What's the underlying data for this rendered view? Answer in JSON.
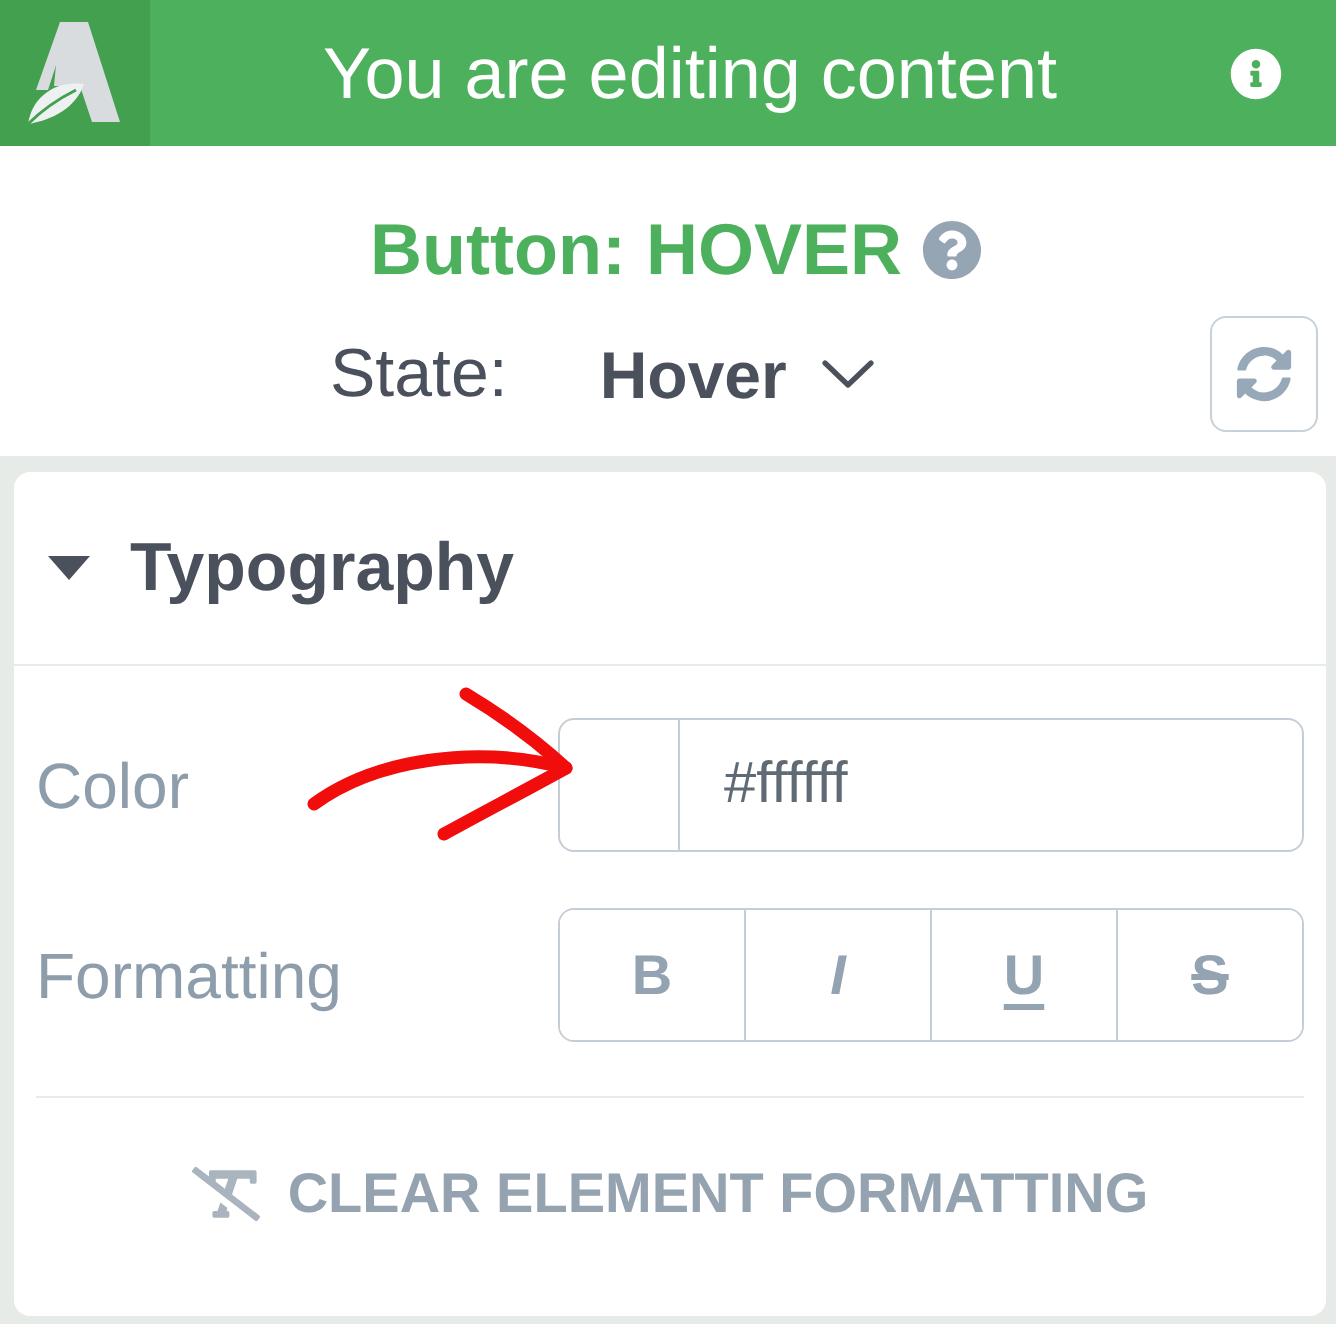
{
  "header": {
    "title": "You are editing content"
  },
  "element": {
    "title": "Button: HOVER"
  },
  "state": {
    "label": "State:",
    "value": "Hover"
  },
  "section": {
    "title": "Typography",
    "expanded": true,
    "rows": [
      {
        "kind": "color",
        "label": "Color",
        "value": "#ffffff"
      },
      {
        "kind": "formatting",
        "label": "Formatting",
        "buttons": [
          {
            "kind": "bold",
            "label": "B",
            "selected": false
          },
          {
            "kind": "italic",
            "label": "I",
            "selected": false
          },
          {
            "kind": "underline",
            "label": "U",
            "selected": false
          },
          {
            "kind": "strikethrough",
            "label": "S",
            "selected": false
          }
        ]
      }
    ],
    "clear_button": {
      "label": "CLEAR ELEMENT FORMATTING"
    }
  }
}
